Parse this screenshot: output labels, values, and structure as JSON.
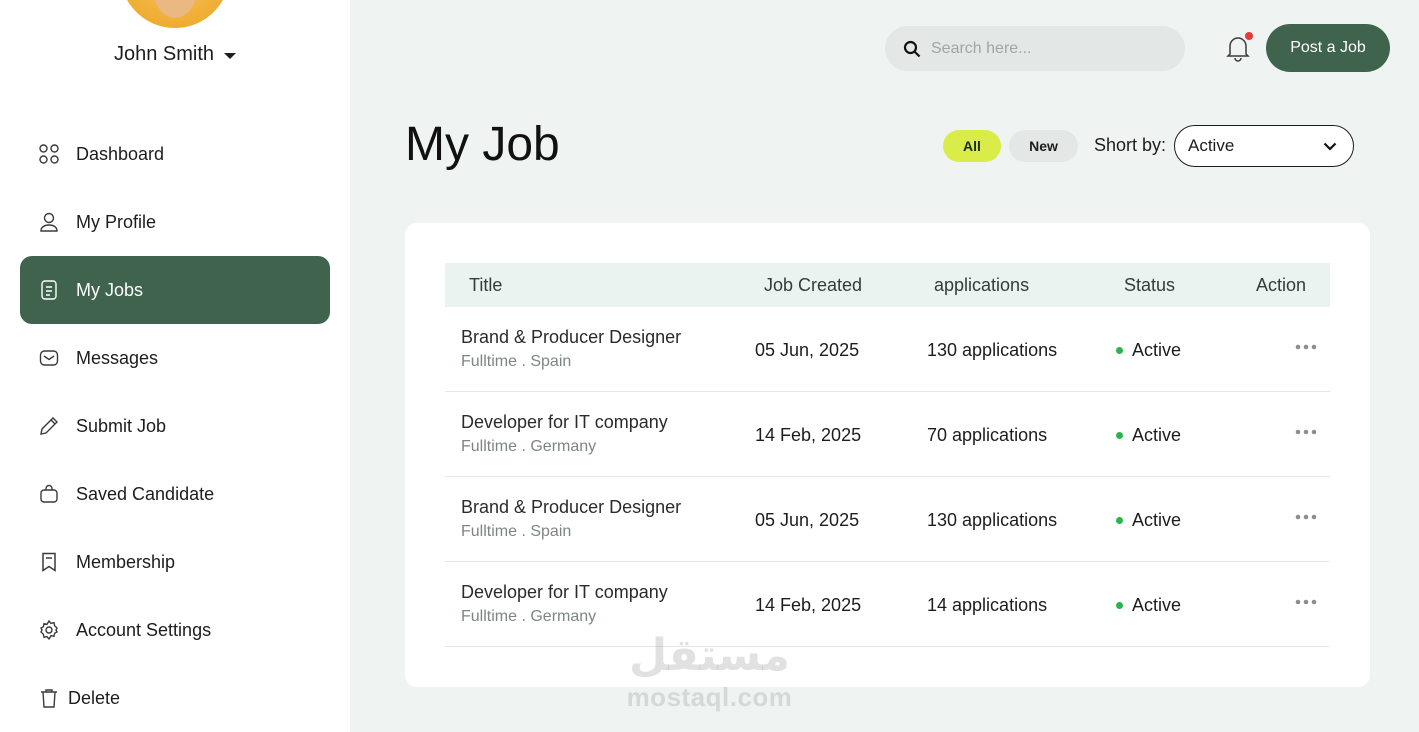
{
  "user": {
    "name": "John Smith"
  },
  "sidebar": {
    "items": [
      {
        "label": "Dashboard",
        "icon": "grid-icon"
      },
      {
        "label": "My Profile",
        "icon": "user-icon"
      },
      {
        "label": "My Jobs",
        "icon": "document-icon",
        "active": true
      },
      {
        "label": "Messages",
        "icon": "mail-icon"
      },
      {
        "label": "Submit Job",
        "icon": "pencil-icon"
      },
      {
        "label": "Saved Candidate",
        "icon": "bag-icon"
      },
      {
        "label": "Membership",
        "icon": "bookmark-icon"
      },
      {
        "label": "Account Settings",
        "icon": "gear-icon"
      },
      {
        "label": "Delete",
        "icon": "trash-icon"
      }
    ]
  },
  "header": {
    "search_placeholder": "Search here...",
    "post_job_label": "Post a Job"
  },
  "page": {
    "title": "My Job",
    "filters": {
      "all": "All",
      "new": "New",
      "active_filter": "All"
    },
    "sort_label": "Short by:",
    "sort_value": "Active"
  },
  "table": {
    "columns": [
      "Title",
      "Job Created",
      "applications",
      "Status",
      "Action"
    ],
    "rows": [
      {
        "title": "Brand & Producer Designer",
        "meta": "Fulltime . Spain",
        "created": "05 Jun, 2025",
        "applications": "130 applications",
        "status": "Active"
      },
      {
        "title": "Developer for IT company",
        "meta": "Fulltime . Germany",
        "created": "14 Feb, 2025",
        "applications": "70 applications",
        "status": "Active"
      },
      {
        "title": "Brand & Producer Designer",
        "meta": "Fulltime . Spain",
        "created": "05 Jun, 2025",
        "applications": "130 applications",
        "status": "Active"
      },
      {
        "title": "Developer for IT company",
        "meta": "Fulltime . Germany",
        "created": "14 Feb, 2025",
        "applications": "14 applications",
        "status": "Active"
      }
    ]
  },
  "watermark": {
    "arabic": "مستقل",
    "latin": "mostaql.com"
  },
  "colors": {
    "brand_green": "#3f634c",
    "accent_lime": "#d9ec48",
    "status_green": "#2bb44a",
    "notification_red": "#e53935",
    "page_bg": "#eff4f2"
  }
}
